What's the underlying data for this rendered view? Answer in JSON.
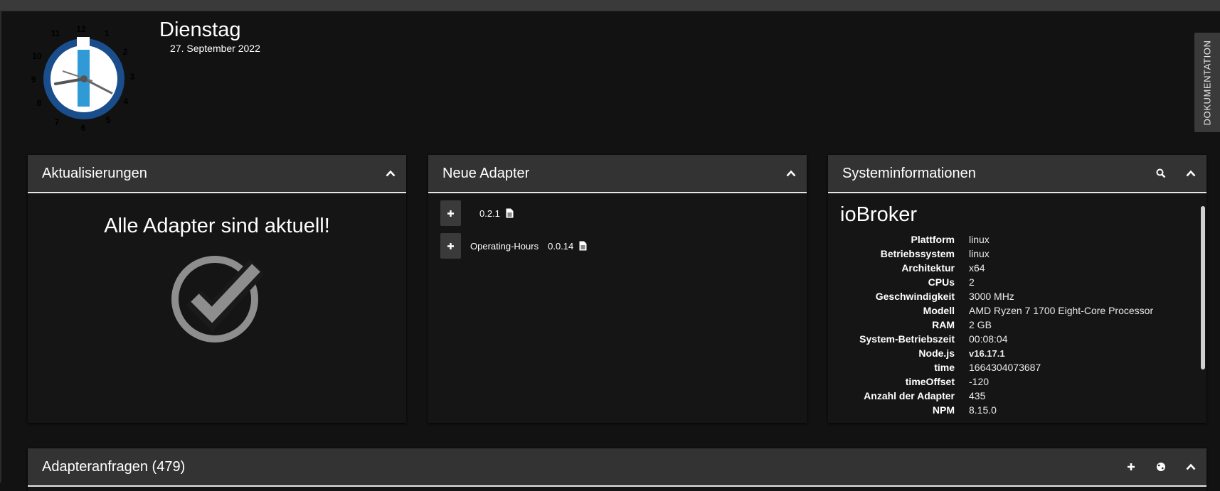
{
  "header": {
    "day": "Dienstag",
    "date": "27. September 2022",
    "clock_numbers": [
      "12",
      "1",
      "2",
      "3",
      "4",
      "5",
      "6",
      "7",
      "8",
      "9",
      "10",
      "11"
    ],
    "doc_tab_label": "DOKUMENTATION"
  },
  "updates": {
    "title": "Aktualisierungen",
    "message": "Alle Adapter sind aktuell!"
  },
  "new_adapters": {
    "title": "Neue Adapter",
    "items": [
      {
        "name": "",
        "version": "0.2.1"
      },
      {
        "name": "Operating-Hours",
        "version": "0.0.14"
      }
    ]
  },
  "system": {
    "title": "Systeminformationen",
    "brand": "ioBroker",
    "rows": [
      {
        "key": "Plattform",
        "value": "linux"
      },
      {
        "key": "Betriebssystem",
        "value": "linux"
      },
      {
        "key": "Architektur",
        "value": "x64"
      },
      {
        "key": "CPUs",
        "value": "2"
      },
      {
        "key": "Geschwindigkeit",
        "value": "3000 MHz"
      },
      {
        "key": "Modell",
        "value": "AMD Ryzen 7 1700 Eight-Core Processor"
      },
      {
        "key": "RAM",
        "value": "2 GB"
      },
      {
        "key": "System-Betriebszeit",
        "value": "00:08:04"
      },
      {
        "key": "Node.js",
        "value": "v16.17.1"
      },
      {
        "key": "time",
        "value": "1664304073687"
      },
      {
        "key": "timeOffset",
        "value": "-120"
      },
      {
        "key": "Anzahl der Adapter",
        "value": "435"
      },
      {
        "key": "NPM",
        "value": "8.15.0"
      }
    ]
  },
  "requests": {
    "title": "Adapteranfragen (479)"
  },
  "colors": {
    "background": "#121212",
    "card_header": "#333333",
    "logo_blue": "#1a4d8c",
    "logo_light_blue": "#2f9ad6",
    "check_gray": "#8e8e8e"
  }
}
